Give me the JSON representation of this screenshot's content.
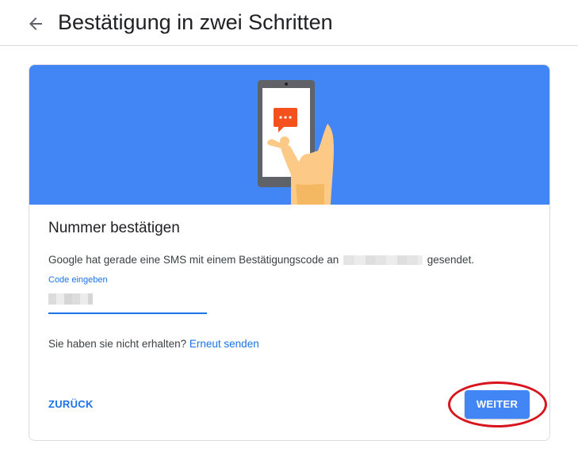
{
  "header": {
    "title": "Bestätigung in zwei Schritten",
    "back_icon": "arrow-back-icon"
  },
  "card": {
    "banner": {
      "illustration": "hand-holding-phone-with-sms-icon",
      "background_color": "#4285f4",
      "message_icon_color": "#f4511e"
    },
    "title": "Nummer bestätigen",
    "description_prefix": "Google hat gerade eine SMS mit einem Bestätigungscode an",
    "description_suffix": "gesendet.",
    "code_field": {
      "label": "Code eingeben"
    },
    "resend_prompt": "Sie haben sie nicht erhalten?",
    "resend_link": "Erneut senden",
    "back_button": "ZURÜCK",
    "next_button": "WEITER"
  },
  "colors": {
    "accent": "#1a73e8",
    "button": "#4285f4",
    "highlight_circle": "#d8141c"
  }
}
